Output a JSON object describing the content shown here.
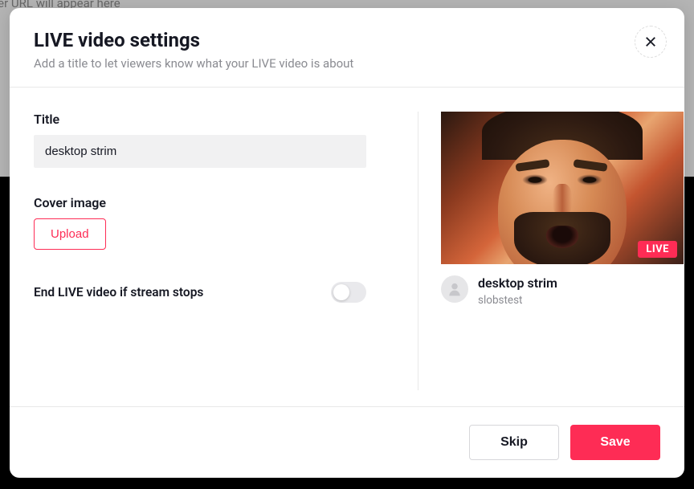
{
  "backdrop_hint": "ver URL will appear here",
  "modal": {
    "title": "LIVE video settings",
    "subtitle": "Add a title to let viewers know what your LIVE video is about"
  },
  "form": {
    "title_label": "Title",
    "title_value": "desktop strim",
    "cover_label": "Cover image",
    "upload_label": "Upload",
    "end_stream_label": "End LIVE video if stream stops",
    "end_stream_toggle": false
  },
  "preview": {
    "live_badge": "LIVE",
    "title": "desktop strim",
    "username": "slobstest"
  },
  "footer": {
    "skip_label": "Skip",
    "save_label": "Save"
  },
  "colors": {
    "accent": "#fe2c55"
  }
}
